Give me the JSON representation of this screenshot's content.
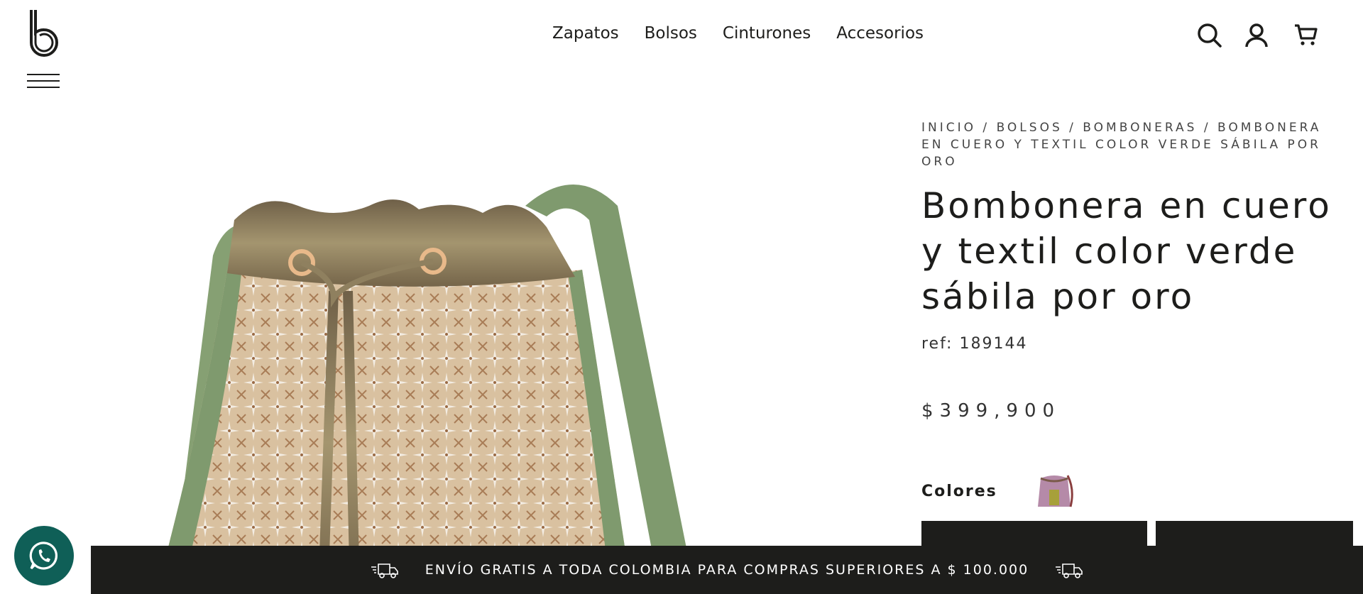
{
  "header": {
    "nav": [
      "Zapatos",
      "Bolsos",
      "Cinturones",
      "Accesorios"
    ],
    "icons": [
      "search-icon",
      "user-icon",
      "cart-icon"
    ]
  },
  "breadcrumb": {
    "items": [
      "INICIO",
      "BOLSOS",
      "BOMBONERAS"
    ],
    "current": "BOMBONERA EN CUERO Y TEXTIL COLOR VERDE SÁBILA POR ORO",
    "separator": " / "
  },
  "product": {
    "title": "Bombonera en cuero y textil color verde sábila por oro",
    "ref": "ref: 189144",
    "price": "$399,900",
    "colors_label": "Colores"
  },
  "banner": {
    "text": "ENVÍO GRATIS A TODA COLOMBIA PARA COMPRAS SUPERIORES A $ 100.000"
  },
  "colors": {
    "dark": "#1d1d1b",
    "whatsapp": "#0f5f57",
    "strap_green": "#7f9a6e",
    "metallic_gold": "#8a7a5c",
    "textile_tan": "#c9a985"
  }
}
